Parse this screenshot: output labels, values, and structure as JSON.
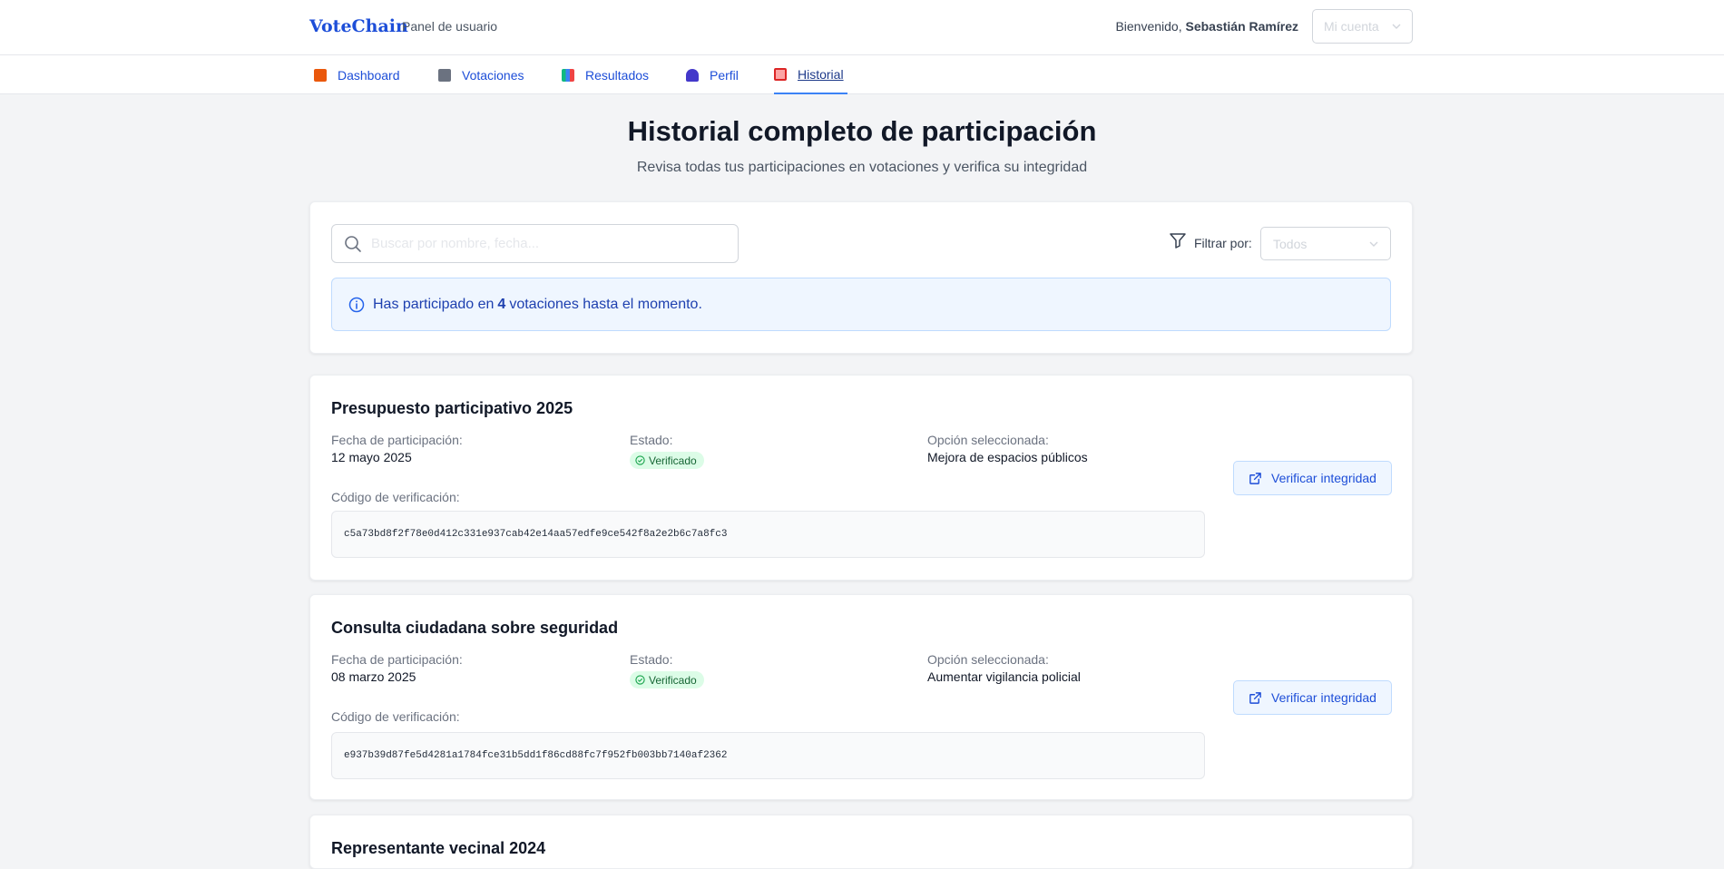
{
  "header": {
    "brand": "VoteChain",
    "subtitle": "Panel de usuario",
    "welcome_prefix": "Bienvenido,",
    "user_name": "Sebastián Ramírez",
    "account_label": "Mi cuenta"
  },
  "nav": {
    "items": [
      {
        "label": "Dashboard",
        "icon": "house-icon",
        "color": "#c2410c"
      },
      {
        "label": "Votaciones",
        "icon": "ballot-box-icon",
        "color": "#6b7280"
      },
      {
        "label": "Resultados",
        "icon": "bar-chart-icon",
        "color": "#7c8fa8"
      },
      {
        "label": "Perfil",
        "icon": "person-icon",
        "color": "#4338ca"
      },
      {
        "label": "Historial",
        "icon": "history-icon",
        "color": "#dc2626"
      }
    ],
    "active": "Historial"
  },
  "page": {
    "title": "Historial completo de participación",
    "subtitle": "Revisa todas tus participaciones en votaciones y verifica su integridad"
  },
  "filters": {
    "search_placeholder": "Buscar por nombre, fecha...",
    "filter_label": "Filtrar por:",
    "filter_value": "Todos"
  },
  "summary": {
    "prefix": "Has participado en",
    "count": "4",
    "suffix": "votaciones hasta el momento."
  },
  "labels": {
    "date": "Fecha de participación:",
    "status": "Estado:",
    "option": "Opción seleccionada:",
    "code": "Código de verificación:",
    "verify_button": "Verificar integridad"
  },
  "votes": [
    {
      "title": "Presupuesto participativo 2025",
      "date": "12 mayo 2025",
      "status": "Verificado",
      "option": "Mejora de espacios públicos",
      "hash": "c5a73bd8f2f78e0d412c331e937cab42e14aa57edfe9ce542f8a2e2b6c7a8fc3"
    },
    {
      "title": "Consulta ciudadana sobre seguridad",
      "date": "08 marzo 2025",
      "status": "Verificado",
      "option": "Aumentar vigilancia policial",
      "hash": "e937b39d87fe5d4281a1784fce31b5dd1f86cd88fc7f952fb003bb7140af2362"
    },
    {
      "title": "Representante vecinal 2024"
    }
  ],
  "colors": {
    "accent": "#1d4ed8",
    "verified_bg": "#dcfce7",
    "verified_text": "#166534"
  }
}
